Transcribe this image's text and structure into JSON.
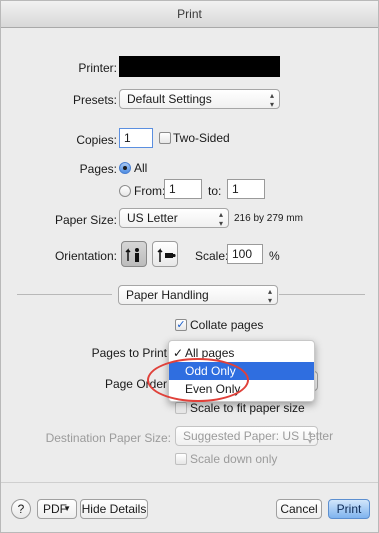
{
  "window": {
    "title": "Print"
  },
  "printer": {
    "label": "Printer:",
    "value": ""
  },
  "presets": {
    "label": "Presets:",
    "value": "Default Settings"
  },
  "copies": {
    "label": "Copies:",
    "value": "1",
    "two_sided_label": "Two-Sided",
    "two_sided_checked": false
  },
  "pages": {
    "label": "Pages:",
    "all_label": "All",
    "from_label": "From:",
    "from_value": "1",
    "to_label": "to:",
    "to_value": "1"
  },
  "paper_size": {
    "label": "Paper Size:",
    "value": "US Letter",
    "dimensions": "216 by 279 mm"
  },
  "orientation": {
    "label": "Orientation:",
    "scale_label": "Scale:",
    "scale_value": "100",
    "scale_unit": "%"
  },
  "section": {
    "value": "Paper Handling"
  },
  "collate": {
    "label": "Collate pages",
    "checked": true
  },
  "pages_to_print": {
    "label": "Pages to Print"
  },
  "page_order": {
    "label": "Page Order"
  },
  "dropdown_menu": {
    "check_mark": "✓",
    "items": [
      "All pages",
      "Odd Only",
      "Even Only"
    ],
    "checked_index": 0,
    "highlighted_index": 1
  },
  "scale_to_fit": {
    "label": "Scale to fit paper size"
  },
  "destination_paper_size": {
    "label": "Destination Paper Size:",
    "value": "Suggested Paper: US Letter"
  },
  "scale_down": {
    "label": "Scale down only"
  },
  "bottom_bar": {
    "help_label": "?",
    "pdf_label": "PDF",
    "hide_details_label": "Hide Details",
    "cancel_label": "Cancel",
    "print_label": "Print"
  },
  "colors": {
    "accent": "#2f6ee0",
    "default_button": "#7fb3ee",
    "annotation": "#e0413a",
    "printer_redaction": "#000000"
  }
}
